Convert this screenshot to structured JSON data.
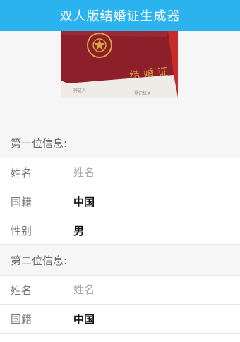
{
  "header": {
    "title": "双人版结婚证生成器"
  },
  "banner": {
    "cover_text": "结 婚 证",
    "small_text_1": "持证人",
    "small_text_2": "登记机关"
  },
  "person1": {
    "section_label": "第一位信息:",
    "name_label": "姓名",
    "name_placeholder": "姓名",
    "nationality_label": "国籍",
    "nationality_value": "中国",
    "gender_label": "性别",
    "gender_value": "男"
  },
  "person2": {
    "section_label": "第二位信息:",
    "name_label": "姓名",
    "name_placeholder": "姓名",
    "nationality_label": "国籍",
    "nationality_value": "中国"
  }
}
